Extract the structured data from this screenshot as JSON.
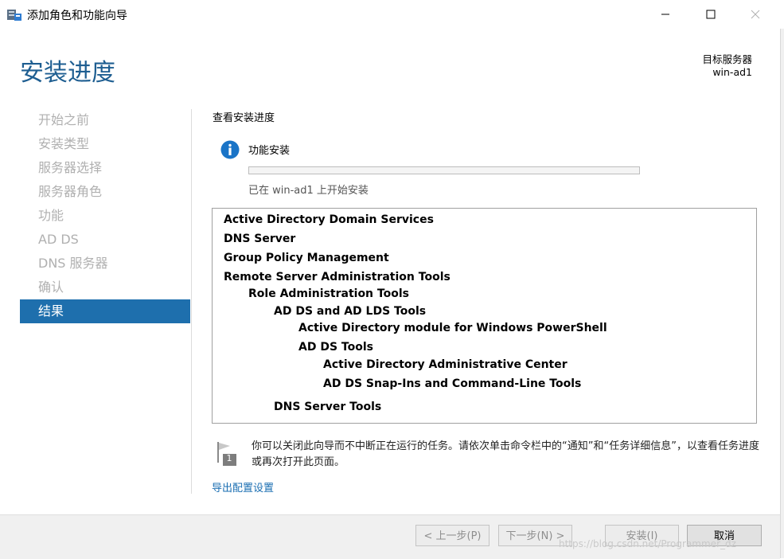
{
  "window": {
    "title": "添加角色和功能向导",
    "icons": [
      "server-manager-icon",
      "minimize-icon",
      "maximize-icon",
      "close-icon"
    ]
  },
  "page_title": "安装进度",
  "target_server": {
    "label": "目标服务器",
    "name": "win-ad1"
  },
  "sidebar": {
    "items": [
      {
        "label": "开始之前",
        "active": false
      },
      {
        "label": "安装类型",
        "active": false
      },
      {
        "label": "服务器选择",
        "active": false
      },
      {
        "label": "服务器角色",
        "active": false
      },
      {
        "label": "功能",
        "active": false
      },
      {
        "label": "AD DS",
        "active": false
      },
      {
        "label": "DNS 服务器",
        "active": false
      },
      {
        "label": "确认",
        "active": false
      },
      {
        "label": "结果",
        "active": true
      }
    ]
  },
  "main": {
    "heading": "查看安装进度",
    "info_icon": "info-icon",
    "feature_install_label": "功能安装",
    "progress_fraction": 0,
    "progress_status": "已在 win-ad1 上开始安装",
    "features": [
      {
        "label": "Active Directory Domain Services",
        "level": 0
      },
      {
        "label": "DNS Server",
        "level": 0
      },
      {
        "label": "Group Policy Management",
        "level": 0
      },
      {
        "label": "Remote Server Administration Tools",
        "level": 0
      },
      {
        "label": "Role Administration Tools",
        "level": 1
      },
      {
        "label": "AD DS and AD LDS Tools",
        "level": 2
      },
      {
        "label": "Active Directory module for Windows PowerShell",
        "level": 3
      },
      {
        "label": "AD DS Tools",
        "level": 3
      },
      {
        "label": "Active Directory Administrative Center",
        "level": 4
      },
      {
        "label": "AD DS Snap-Ins and Command-Line Tools",
        "level": 4
      },
      {
        "label": "DNS Server Tools",
        "level": 2
      }
    ],
    "note_icon": "notification-flag-icon",
    "note_badge": "1",
    "note": "你可以关闭此向导而不中断正在运行的任务。请依次单击命令栏中的“通知”和“任务详细信息”，以查看任务进度或再次打开此页面。",
    "export_link": "导出配置设置"
  },
  "footer": {
    "prev_label": "< 上一步(P)",
    "next_label": "下一步(N) >",
    "install_label": "安装(I)",
    "cancel_label": "取消"
  },
  "watermark": "https://blog.csdn.net/Programmer_dz",
  "colors": {
    "accent": "#1e6fad",
    "title": "#1e5e91",
    "link": "#1a6eb2",
    "info": "#1a74c7",
    "progress": "#06b025"
  }
}
